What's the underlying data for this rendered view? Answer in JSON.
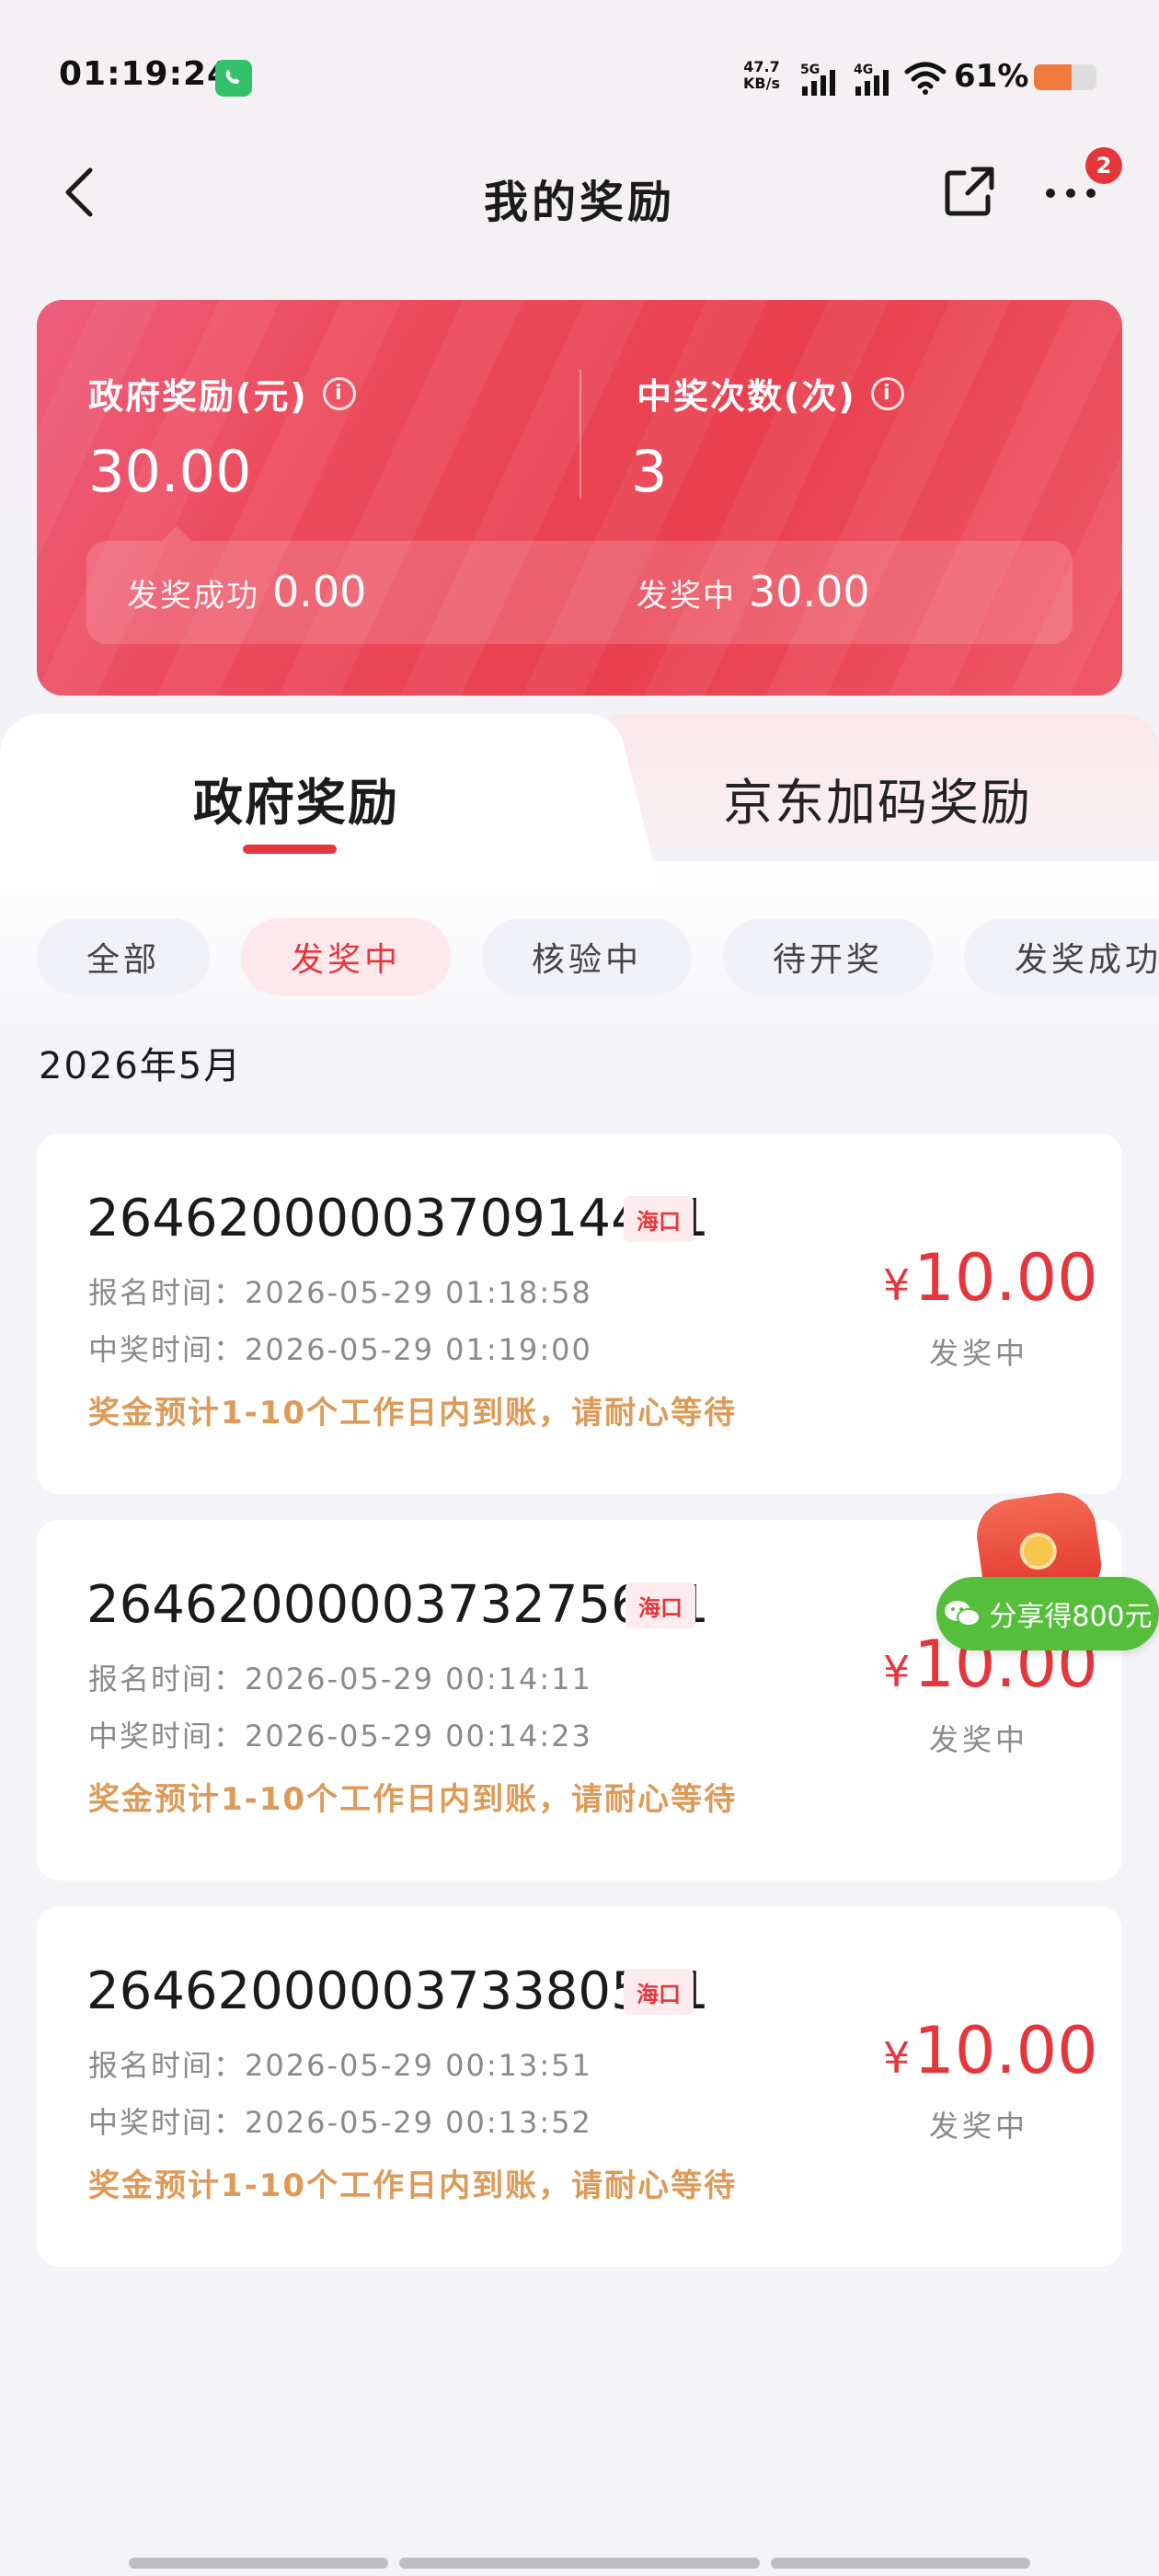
{
  "status_bar": {
    "time": "01:19:24",
    "net_speed_value": "47.7",
    "net_speed_unit": "KB/s",
    "sig1_label": "5G",
    "sig2_label": "4G",
    "battery_pct": "61%",
    "battery_level": 0.61
  },
  "nav": {
    "title": "我的奖励",
    "more_badge": "2"
  },
  "summary": {
    "gov_label": "政府奖励(元)",
    "gov_value": "30.00",
    "count_label": "中奖次数(次)",
    "count_value": "3",
    "paid_label": "发奖成功",
    "paid_value": "0.00",
    "pending_label": "发奖中",
    "pending_value": "30.00"
  },
  "tabs": [
    {
      "label": "政府奖励",
      "active": true
    },
    {
      "label": "京东加码奖励",
      "active": false
    }
  ],
  "filters": [
    {
      "label": "全部",
      "active": false
    },
    {
      "label": "发奖中",
      "active": true
    },
    {
      "label": "核验中",
      "active": false
    },
    {
      "label": "待开奖",
      "active": false
    },
    {
      "label": "发奖成功",
      "active": false
    }
  ],
  "month": "2026年5月",
  "records": [
    {
      "id": "2646200000370914421",
      "region": "海口",
      "signup": "报名时间：2026-05-29 01:18:58",
      "win": "中奖时间：2026-05-29 01:19:00",
      "note": "奖金预计1-10个工作日内到账，请耐心等待",
      "currency": "¥",
      "amount": "10.00",
      "status": "发奖中"
    },
    {
      "id": "2646200000373275601",
      "region": "海口",
      "signup": "报名时间：2026-05-29 00:14:11",
      "win": "中奖时间：2026-05-29 00:14:23",
      "note": "奖金预计1-10个工作日内到账，请耐心等待",
      "currency": "¥",
      "amount": "10.00",
      "status": "发奖中"
    },
    {
      "id": "2646200000373380511",
      "region": "海口",
      "signup": "报名时间：2026-05-29 00:13:51",
      "win": "中奖时间：2026-05-29 00:13:52",
      "note": "奖金预计1-10个工作日内到账，请耐心等待",
      "currency": "¥",
      "amount": "10.00",
      "status": "发奖中"
    }
  ],
  "float_share": {
    "label": "分享得800元"
  },
  "colors": {
    "accent_red": "#e5373b",
    "note_orange": "#dd9a58",
    "wechat_green": "#55bf3b"
  }
}
